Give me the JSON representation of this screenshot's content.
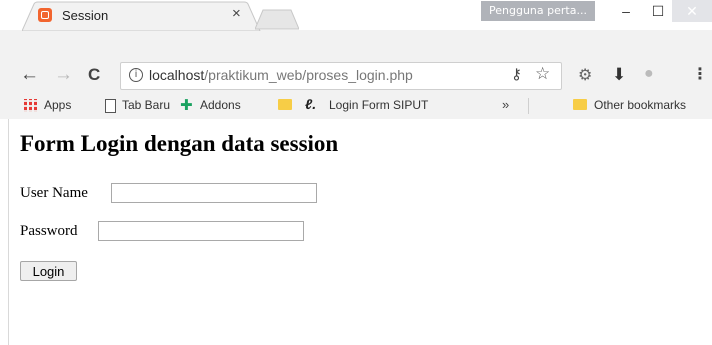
{
  "window": {
    "user_badge": "Pengguna perta...",
    "minimize": "–",
    "maximize": "☐",
    "close": "✕"
  },
  "tab": {
    "title": "Session",
    "close": "×"
  },
  "toolbar": {
    "back": "←",
    "forward": "→",
    "reload": "C",
    "info": "i",
    "url_host": "localhost",
    "url_path": "/praktikum_web/proses_login.php",
    "key": "⚷",
    "star": "☆",
    "menu": "⋮"
  },
  "bookmarks": {
    "items": [
      {
        "label": "Apps"
      },
      {
        "label": "Tab Baru"
      },
      {
        "label": "Addons"
      },
      {
        "label": ""
      },
      {
        "label": "Login Form SIPUT"
      }
    ],
    "overflow": "»",
    "other": "Other bookmarks"
  },
  "page": {
    "heading": "Form Login dengan data session",
    "username_label": "User Name",
    "password_label": "Password",
    "username_value": "",
    "password_value": "",
    "login_button": "Login"
  }
}
